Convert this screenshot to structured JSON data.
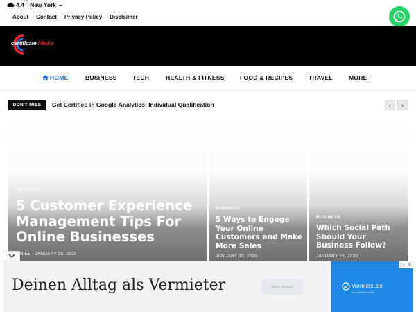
{
  "topbar": {
    "weather_temp": "4.4",
    "weather_unit": "C",
    "weather_city": "New York",
    "weather_sep": "–",
    "links": [
      "About",
      "Contact",
      "Privacy Policy",
      "Disclaimer"
    ],
    "whatsapp_icon": "whatsapp-icon"
  },
  "header": {
    "logo_word1": "certificate",
    "logo_word2": "Media"
  },
  "nav": {
    "items": [
      "HOME",
      "BUSINESS",
      "TECH",
      "HEALTH & FITNESS",
      "FOOD & RECIPES",
      "TRAVEL",
      "MORE"
    ]
  },
  "ticker": {
    "badge": "DON'T MISS",
    "headline": "Get Certified in Google Analytics: Individual Qualification",
    "prev": "‹",
    "next": "›"
  },
  "cards": [
    {
      "category": "BUSINESS",
      "title": "5 Customer Experience Management Tips For Online Businesses",
      "meta": "NIEL - JANUARY 25, 2020"
    },
    {
      "category": "BUSINESS",
      "title": "5 Ways to Engage Your Online Customers and Make More Sales",
      "meta": "JANUARY 20, 2020"
    },
    {
      "category": "BUSINESS",
      "title": "Which Social Path Should Your Business Follow?",
      "meta": "JANUARY 15, 2020"
    }
  ],
  "ad": {
    "headline": "Deinen Alltag als Vermieter",
    "button": "Jetzt testen",
    "brand": "Vermietet.de",
    "brand_sub": "von ImmoScout24",
    "close_icon": "chevron-down-icon",
    "info_icon": "ad-info-icon"
  },
  "colors": {
    "accent": "#2a6fd6",
    "header_bg": "#000000",
    "logo_red": "#e3262b",
    "whatsapp": "#25d366",
    "ad_brand": "#1e88e5"
  }
}
